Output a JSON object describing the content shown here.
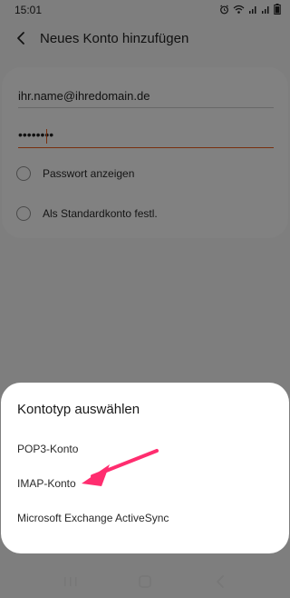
{
  "status_bar": {
    "time": "15:01",
    "icons": [
      "alarm-icon",
      "wifi-icon",
      "signal-icon",
      "signal-icon",
      "battery-icon"
    ]
  },
  "header": {
    "title": "Neues Konto hinzufügen",
    "back_icon": "back-arrow-icon"
  },
  "form": {
    "email_value": "ihr.name@ihredomain.de",
    "password_value": "••••••••",
    "show_password_label": "Passwort anzeigen",
    "default_account_label": "Als Standardkonto festl."
  },
  "sheet": {
    "title": "Kontotyp auswählen",
    "options": [
      {
        "label": "POP3-Konto"
      },
      {
        "label": "IMAP-Konto"
      },
      {
        "label": "Microsoft Exchange ActiveSync"
      }
    ]
  },
  "annotation": {
    "arrow_color": "#ff2d6f"
  },
  "colors": {
    "accent": "#e85b1b",
    "overlay": "#000000",
    "arrow": "#ff2d6f"
  }
}
